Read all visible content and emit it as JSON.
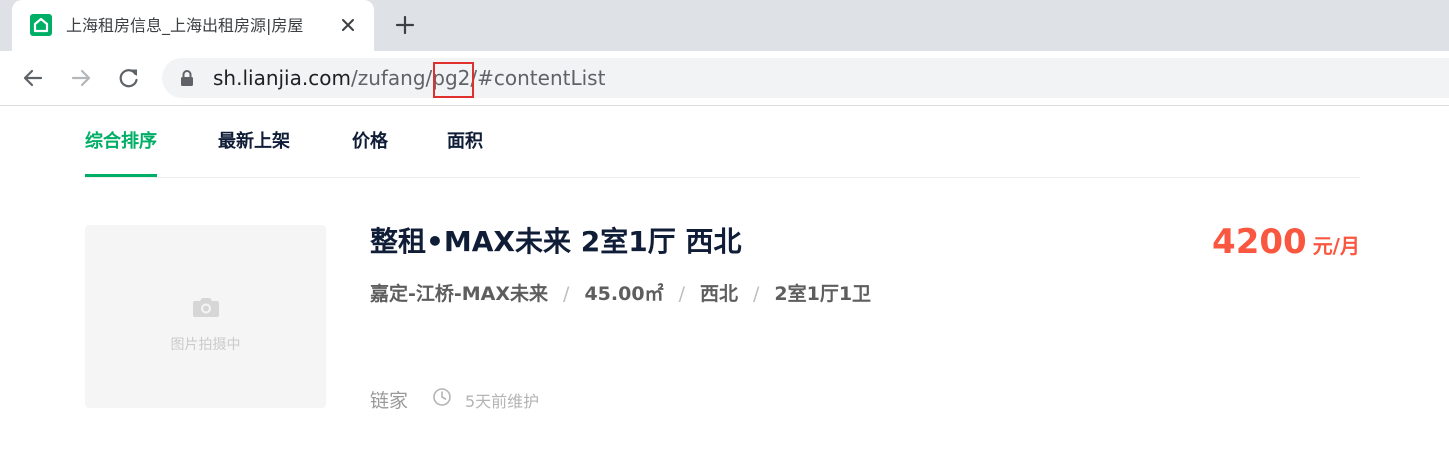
{
  "browser": {
    "tab_title": "上海租房信息_上海出租房源|房屋",
    "url_host": "sh.lianjia.com",
    "url_path_before": "/zufang/",
    "url_highlight": "pg2",
    "url_path_after": "/#contentList",
    "colors": {
      "favicon": "#00ae66",
      "highlight_box": "#e0302d"
    }
  },
  "sort_tabs": [
    {
      "label": "综合排序",
      "active": true
    },
    {
      "label": "最新上架",
      "active": false
    },
    {
      "label": "价格",
      "active": false
    },
    {
      "label": "面积",
      "active": false
    }
  ],
  "listing": {
    "photo_placeholder": "图片拍摄中",
    "title": "整租•MAX未来 2室1厅 西北",
    "location": "嘉定-江桥-MAX未来",
    "area": "45.00㎡",
    "orientation": "西北",
    "layout": "2室1厅1卫",
    "separator": "/",
    "price": "4200",
    "price_unit": "元/月",
    "brand": "链家",
    "maintained": "5天前维护",
    "colors": {
      "accent": "#00ae66",
      "price": "#fa5741"
    }
  }
}
